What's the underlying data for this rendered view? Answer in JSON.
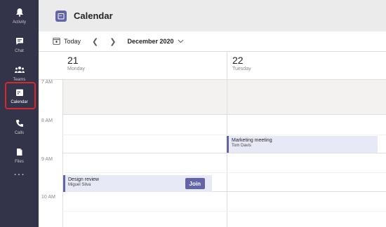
{
  "app": {
    "title": "Calendar"
  },
  "rail": {
    "items": [
      {
        "label": "Activity",
        "icon": "bell-icon"
      },
      {
        "label": "Chat",
        "icon": "chat-icon"
      },
      {
        "label": "Teams",
        "icon": "teams-icon"
      },
      {
        "label": "Calendar",
        "icon": "calendar-icon",
        "active": true
      },
      {
        "label": "Calls",
        "icon": "phone-icon"
      },
      {
        "label": "Files",
        "icon": "file-icon"
      }
    ],
    "more": "..."
  },
  "toolbar": {
    "today_label": "Today",
    "month_label": "December 2020"
  },
  "days": [
    {
      "num": "21",
      "name": "Monday"
    },
    {
      "num": "22",
      "name": "Tuesday"
    }
  ],
  "hours": [
    "7 AM",
    "8 AM",
    "9 AM",
    "10 AM"
  ],
  "events": [
    {
      "title": "Marketing meeting",
      "organizer": "Tom Davis"
    },
    {
      "title": "Design review",
      "organizer": "Miguel Silva",
      "join_label": "Join"
    }
  ],
  "colors": {
    "rail_bg": "#33344a",
    "accent": "#6264a7",
    "highlight": "#d8272d",
    "event_bg": "#e8e9f7"
  }
}
